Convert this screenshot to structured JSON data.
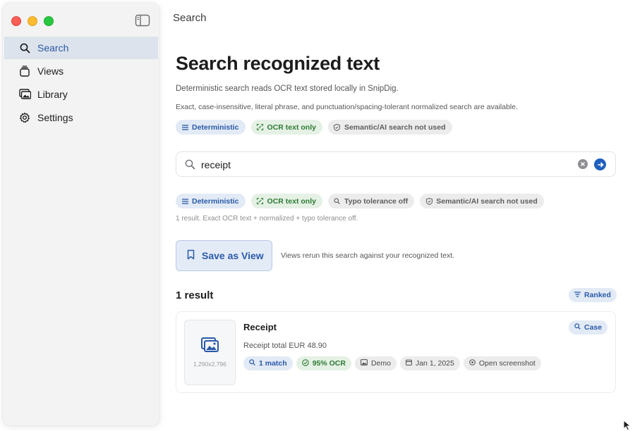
{
  "window": {
    "section_title": "Search"
  },
  "sidebar": {
    "items": [
      {
        "label": "Search",
        "icon": "search-icon",
        "active": true
      },
      {
        "label": "Views",
        "icon": "stack-icon",
        "active": false
      },
      {
        "label": "Library",
        "icon": "photo-library-icon",
        "active": false
      },
      {
        "label": "Settings",
        "icon": "gear-icon",
        "active": false
      }
    ]
  },
  "header": {
    "title": "Search recognized text",
    "description": "Deterministic search reads OCR text stored locally in SnipDig.",
    "subdescription": "Exact, case-insensitive, literal phrase, and punctuation/spacing-tolerant normalized search are available."
  },
  "mode_chips": {
    "deterministic": "Deterministic",
    "ocr_only": "OCR text only",
    "semantic": "Semantic/AI search not used"
  },
  "search": {
    "query": "receipt",
    "placeholder": "Search recognized text"
  },
  "active_chips": {
    "deterministic": "Deterministic",
    "ocr_only": "OCR text only",
    "typo": "Typo tolerance off",
    "semantic": "Semantic/AI search not used"
  },
  "summary": "1 result. Exact OCR text + normalized + typo tolerance off.",
  "save_view": {
    "label": "Save as View",
    "note": "Views rerun this search against your recognized text."
  },
  "results": {
    "heading": "1 result",
    "sort_label": "Ranked",
    "items": [
      {
        "title": "Receipt",
        "snippet": "Receipt total EUR 48.90",
        "dimensions": "1.290x2.796",
        "match_label": "Case",
        "matches": "1 match",
        "ocr": "95% OCR",
        "source": "Demo",
        "date": "Jan 1, 2025",
        "open": "Open screenshot"
      }
    ]
  },
  "colors": {
    "accent": "#2a5aa8",
    "success": "#2f7a36",
    "sidebar_active": "#dde3ec"
  }
}
